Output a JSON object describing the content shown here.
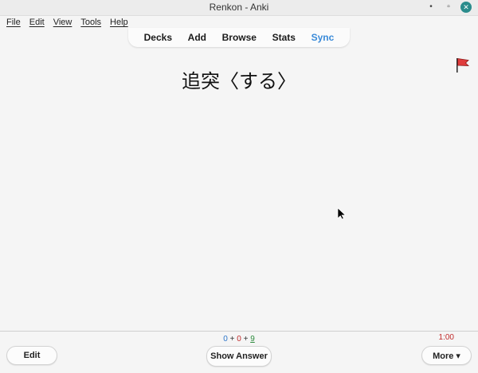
{
  "window": {
    "title": "Renkon - Anki",
    "controls": {
      "minimize": "•",
      "maximize": "▫",
      "close": "✕"
    }
  },
  "menu": [
    "File",
    "Edit",
    "View",
    "Tools",
    "Help"
  ],
  "toolbar": {
    "items": [
      "Decks",
      "Add",
      "Browse",
      "Stats",
      "Sync"
    ],
    "active_color": "#3a8ad8"
  },
  "card": {
    "question": "追突〈する〉",
    "flag_color": "#e03c3c"
  },
  "bottom": {
    "counts": {
      "new": "0",
      "sep1": "+",
      "learn": "0",
      "sep2": "+",
      "review": "9"
    },
    "timer": "1:00",
    "edit_label": "Edit",
    "show_answer_label": "Show Answer",
    "more_label": "More ▾"
  },
  "colors": {
    "new": "#2b74c9",
    "learn": "#c02a2a",
    "review": "#2b8a3b",
    "timer": "#c02a2a"
  }
}
